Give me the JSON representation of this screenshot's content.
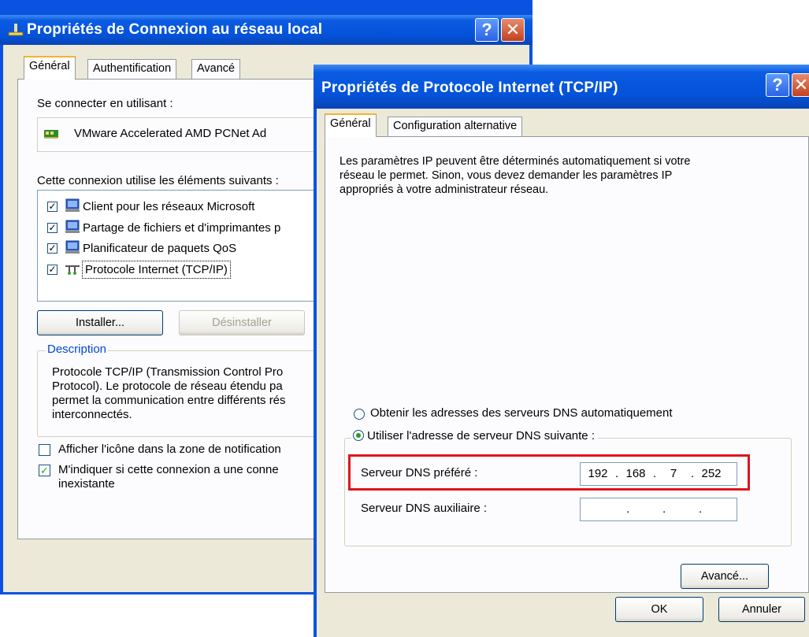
{
  "win1": {
    "title": "Propriétés de Connexion au réseau local",
    "tabs": [
      "Général",
      "Authentification",
      "Avancé"
    ],
    "connect_using_label": "Se connecter en utilisant :",
    "adapter_name": "VMware Accelerated AMD PCNet Ad",
    "items_label": "Cette connexion utilise les éléments suivants :",
    "items": [
      {
        "label": "Client pour les réseaux Microsoft",
        "checked": true,
        "icon": "network-client-icon"
      },
      {
        "label": "Partage de fichiers et d'imprimantes p",
        "checked": true,
        "icon": "file-sharing-icon"
      },
      {
        "label": "Planificateur de paquets QoS",
        "checked": true,
        "icon": "qos-scheduler-icon"
      },
      {
        "label": "Protocole Internet (TCP/IP)",
        "checked": true,
        "icon": "protocol-icon"
      }
    ],
    "install_button": "Installer...",
    "uninstall_button": "Désinstaller",
    "description_legend": "Description",
    "description_text": [
      "Protocole TCP/IP (Transmission Control Pro",
      "Protocol). Le protocole de réseau étendu pa",
      "permet la communication entre différents rés",
      "interconnectés."
    ],
    "show_icon_label": "Afficher l'icône dans la zone de notification",
    "notify_label_line1": "M'indiquer si cette connexion a une conne",
    "notify_label_line2": "inexistante"
  },
  "win2": {
    "title": "Propriétés de Protocole Internet (TCP/IP)",
    "tabs": [
      "Général",
      "Configuration alternative"
    ],
    "intro_lines": [
      "Les paramètres IP peuvent être déterminés automatiquement si votre",
      "réseau le permet. Sinon, vous devez demander les paramètres IP",
      "appropriés à votre administrateur réseau."
    ],
    "dns_auto_label": "Obtenir les adresses des serveurs DNS automatiquement",
    "dns_manual_label": "Utiliser l'adresse de serveur DNS suivante :",
    "preferred_dns_label": "Serveur DNS préféré :",
    "preferred_dns": [
      "192",
      "168",
      "7",
      "252"
    ],
    "alternate_dns_label": "Serveur DNS auxiliaire :",
    "alternate_dns": [
      "",
      "",
      "",
      ""
    ],
    "advanced_button": "Avancé...",
    "ok_button": "OK",
    "cancel_button": "Annuler"
  },
  "colors": {
    "title_bar": "#0452d8",
    "highlight_box": "#e0141e",
    "checkmark": "#21a121"
  }
}
